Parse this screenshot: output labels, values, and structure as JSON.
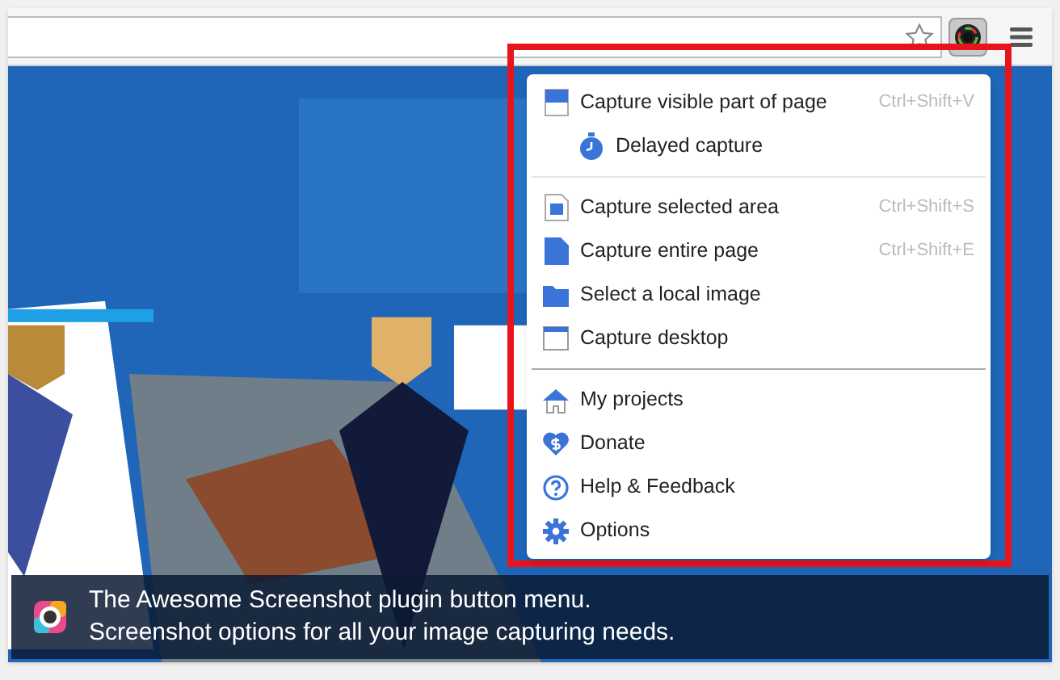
{
  "menu": {
    "sections": [
      {
        "items": [
          {
            "label": "Capture visible part of page",
            "shortcut": "Ctrl+Shift+V",
            "kind": "item"
          },
          {
            "label": "Delayed capture",
            "kind": "subitem"
          }
        ]
      },
      {
        "items": [
          {
            "label": "Capture selected area",
            "shortcut": "Ctrl+Shift+S",
            "kind": "item"
          },
          {
            "label": "Capture entire page",
            "shortcut": "Ctrl+Shift+E",
            "kind": "item"
          },
          {
            "label": "Select a local image",
            "kind": "item"
          },
          {
            "label": "Capture desktop",
            "kind": "item"
          }
        ]
      },
      {
        "items": [
          {
            "label": "My projects",
            "kind": "item"
          },
          {
            "label": "Donate",
            "kind": "item"
          },
          {
            "label": "Help & Feedback",
            "kind": "item"
          },
          {
            "label": "Options",
            "kind": "item"
          }
        ]
      }
    ]
  },
  "caption": {
    "lines": [
      "The Awesome Screenshot plugin button menu.",
      "Screenshot options for all your image capturing needs."
    ]
  }
}
